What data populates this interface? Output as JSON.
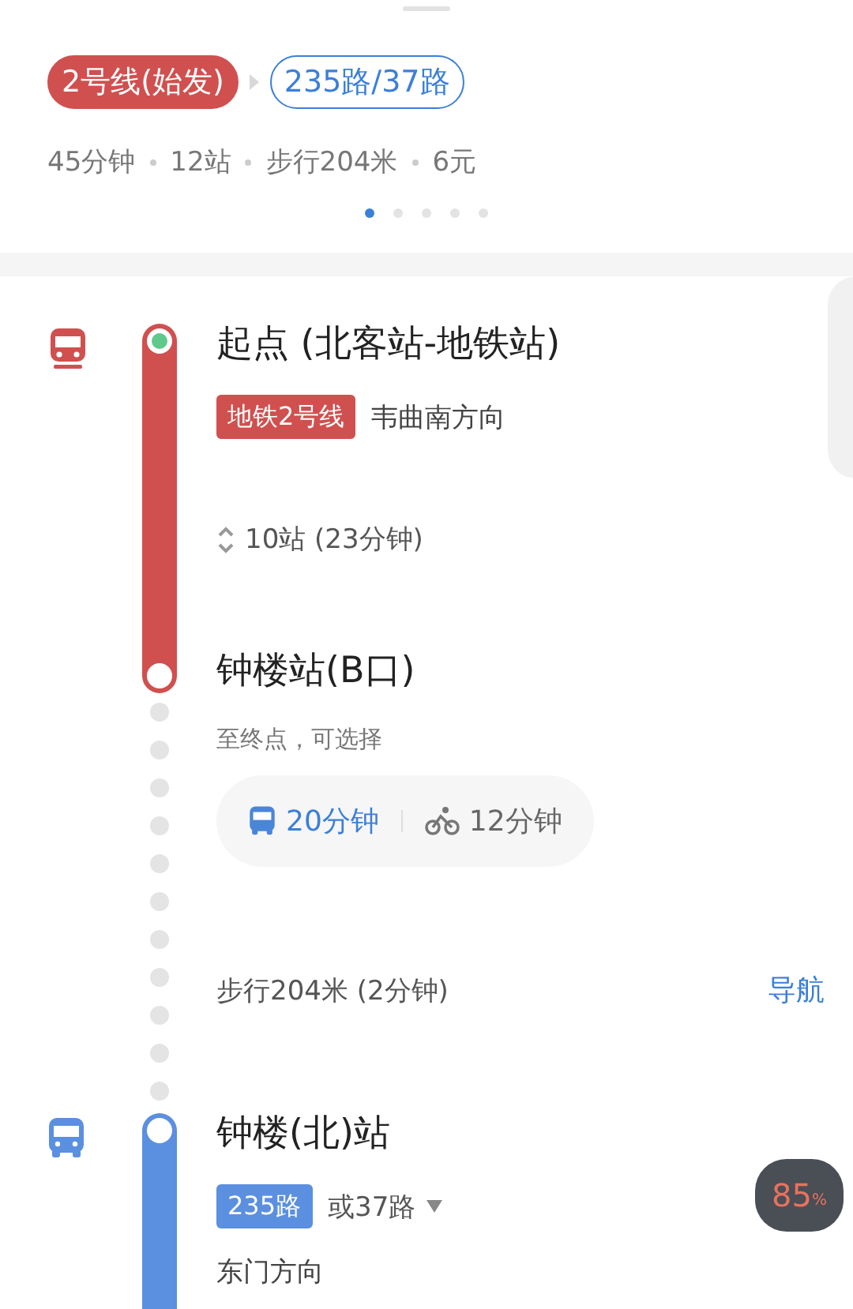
{
  "route": {
    "segments": [
      {
        "label": "2号线(始发)",
        "kind": "subway"
      },
      {
        "label": "235路/37路",
        "kind": "bus"
      }
    ],
    "summary": [
      "45分钟",
      "12站",
      "步行204米",
      "6元"
    ],
    "pages": [
      {
        "selected": true
      },
      {
        "selected": false
      },
      {
        "selected": false
      },
      {
        "selected": false
      },
      {
        "selected": false
      }
    ]
  },
  "legs": [
    {
      "kind": "subway",
      "start": "起点 (北客站-地铁站)",
      "line": "地铁2号线",
      "direction": "韦曲南方向",
      "stops": "10站 (23分钟)",
      "end": "钟楼站(B口)"
    },
    {
      "kind": "walk",
      "note": "至终点，可选择",
      "options": [
        {
          "kind": "bus",
          "label": "20分钟"
        },
        {
          "kind": "bike",
          "label": "12分钟"
        }
      ],
      "walk": "步行204米 (2分钟)",
      "action": "导航"
    },
    {
      "kind": "bus",
      "start": "钟楼(北)站",
      "line": "235路",
      "alternative": "或37路",
      "direction": "东门方向"
    }
  ],
  "badge": {
    "value": "85",
    "unit": "%"
  }
}
